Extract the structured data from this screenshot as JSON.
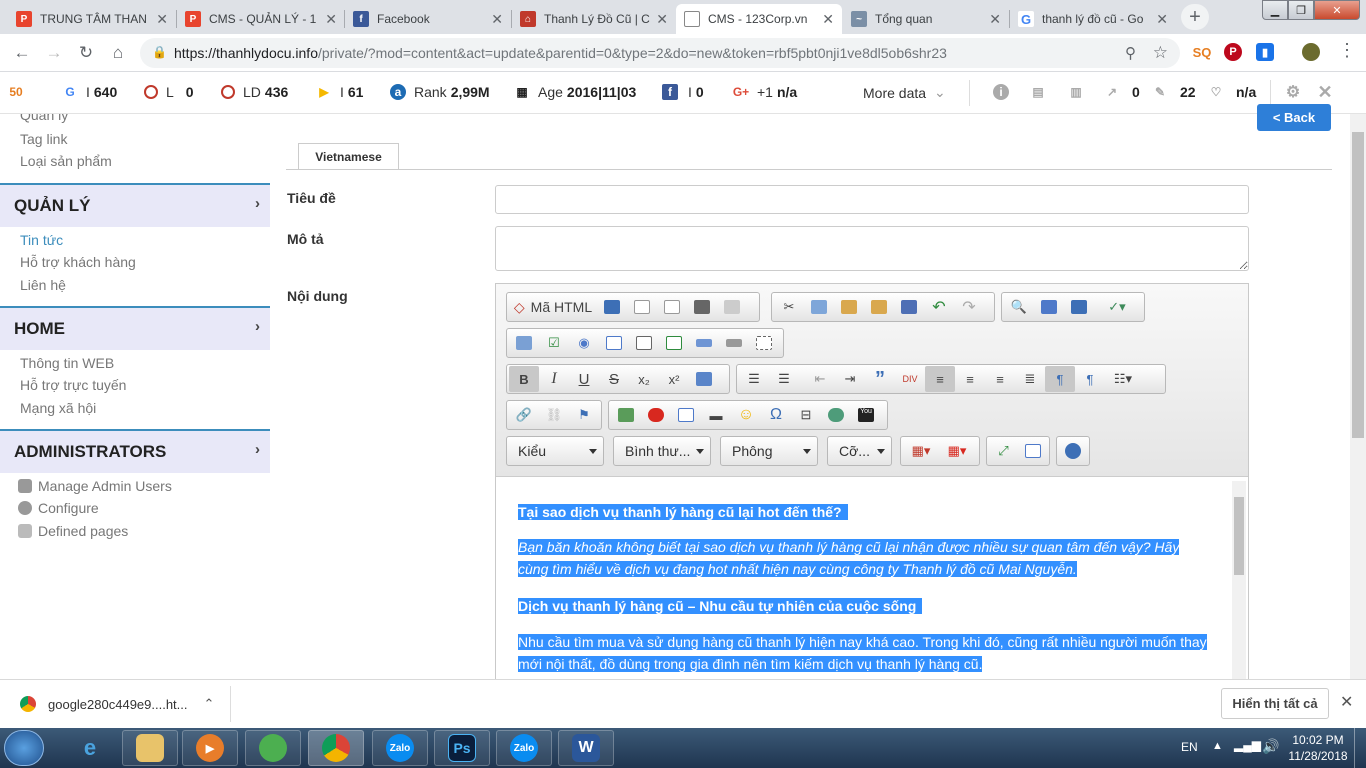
{
  "browser": {
    "tabs": [
      {
        "title": "TRUNG TÂM THAN",
        "favicon": "cms-icon",
        "color": "#e8442e"
      },
      {
        "title": "CMS - QUẢN LÝ - 1",
        "favicon": "cms-icon",
        "color": "#e8442e"
      },
      {
        "title": "Facebook",
        "favicon": "facebook-icon",
        "color": "#3b5998"
      },
      {
        "title": "Thanh Lý Đồ Cũ | C",
        "favicon": "home-icon",
        "color": "#c0392b"
      },
      {
        "title": "CMS - 123Corp.vn",
        "favicon": "document-icon",
        "color": "#888888"
      },
      {
        "title": "Tổng quan",
        "favicon": "analytics-icon",
        "color": "#7b8fa6"
      },
      {
        "title": "thanh lý đồ cũ - Go",
        "favicon": "google-icon",
        "color": "#4285f4"
      }
    ],
    "url_host": "https://thanhlydocu.info",
    "url_path": "/private/?mod=content&act=update&parentid=0&type=2&do=new&token=rbf5pbt0nji1ve8dl5ob6shr23"
  },
  "seobar": {
    "google_index": "I",
    "google_index_value": "640",
    "links_label": "L",
    "links_value": "0",
    "ld_label": "LD",
    "ld_value": "436",
    "bing_label": "I",
    "bing_value": "61",
    "rank_label": "Rank",
    "rank_value": "2,99M",
    "age_label": "Age",
    "age_value": "2016|11|03",
    "fb_label": "I",
    "fb_value": "0",
    "gplus_label": "+1",
    "gplus_value": "n/a",
    "more_data": "More data",
    "external_links": "0",
    "pages": "22",
    "heart": "n/a"
  },
  "sidebar": {
    "top_links": [
      "Quản lý",
      "Tag link",
      "Loại sản phẩm"
    ],
    "sections": [
      {
        "title": "QUẢN LÝ",
        "links": [
          "Tin tức",
          "Hỗ trợ khách hàng",
          "Liên hệ"
        ]
      },
      {
        "title": "HOME",
        "links": [
          "Thông tin WEB",
          "Hỗ trợ trực tuyến",
          "Mạng xã hội"
        ]
      },
      {
        "title": "ADMINISTRATORS",
        "links": [
          "Manage Admin Users",
          "Configure",
          "Defined pages"
        ]
      }
    ]
  },
  "form": {
    "back_button": "< Back",
    "lang_tab": "Vietnamese",
    "title_label": "Tiêu đề",
    "desc_label": "Mô tả",
    "content_label": "Nội dung",
    "title_value": "",
    "desc_value": ""
  },
  "editor": {
    "source_button": "Mã HTML",
    "style_combo": "Kiểu",
    "format_combo": "Bình thư...",
    "font_combo": "Phông",
    "size_combo": "Cỡ...",
    "paragraphs": [
      {
        "text": "Tại sao dịch vụ thanh lý hàng cũ lại hot đến thế?",
        "style": "bold"
      },
      {
        "text": "Bạn băn khoăn không biết tại sao dịch vụ thanh lý hàng cũ lại nhận được nhiều sự quan tâm đến vậy? Hãy cùng tìm hiểu về dịch vụ đang hot nhất hiện nay cùng công ty Thanh lý đồ cũ Mai Nguyễn.",
        "style": "italic"
      },
      {
        "text": "Dịch vụ thanh lý hàng cũ – Nhu cầu tự nhiên của cuộc sống",
        "style": "bold"
      },
      {
        "text": "Nhu cầu tìm mua và sử dụng hàng cũ thanh lý hiện nay khá cao. Trong khi đó, cũng rất nhiều người muốn thay mới nội thất, đồ dùng trong gia đình nên tìm kiếm dịch vụ thanh lý hàng cũ.",
        "style": "normal"
      }
    ]
  },
  "downloads": {
    "file": "google280c449e9....ht...",
    "show_all": "Hiển thị tất cả"
  },
  "taskbar": {
    "lang": "EN",
    "time": "10:02 PM",
    "date": "11/28/2018",
    "apps": [
      "Zalo",
      "Ps",
      "Zalo",
      "W"
    ]
  },
  "colors": {
    "accent": "#3c8dbc",
    "selection": "#3390ff",
    "back_button": "#2e7fd8",
    "sidebar_head": "#e8e8f8"
  }
}
